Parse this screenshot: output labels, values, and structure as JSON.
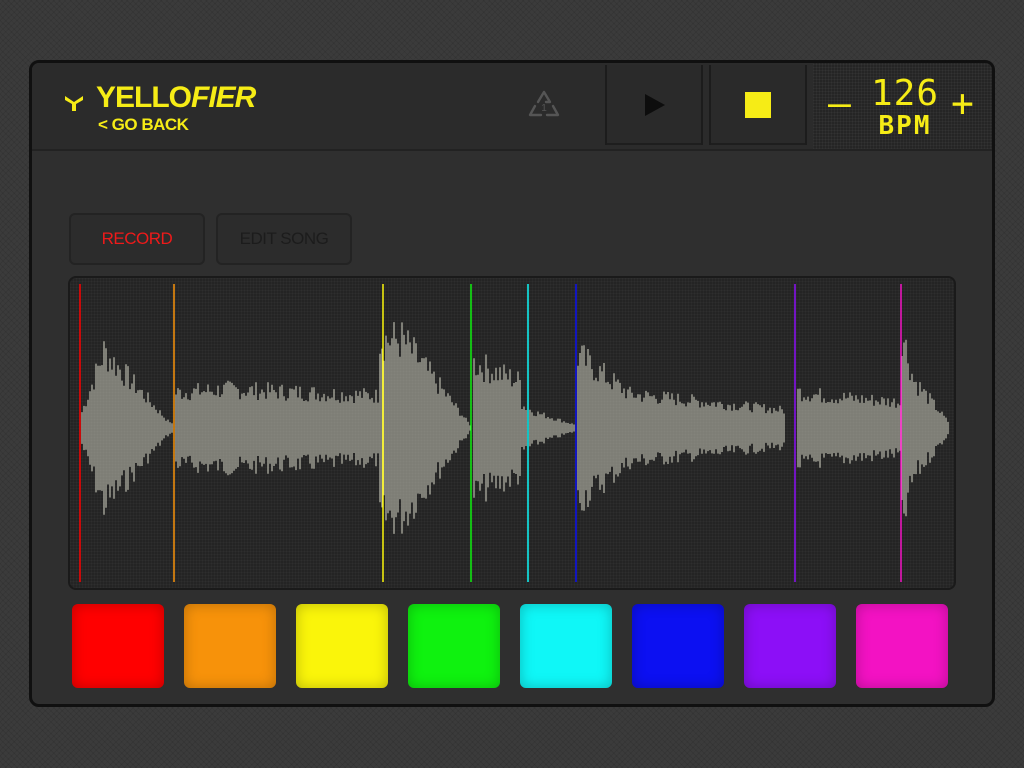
{
  "header": {
    "brand_part1": "YELLO",
    "brand_part2": "FIER",
    "go_back": "< GO BACK",
    "logo_icon": "yellofier-logo-icon",
    "recycle_icon": "recycle-icon",
    "recycle_badge": "1"
  },
  "transport": {
    "play_icon": "play-icon",
    "stop_icon": "stop-icon",
    "bpm_value": "126",
    "bpm_label": "BPM",
    "bpm_minus": "–",
    "bpm_plus": "+"
  },
  "tabs": [
    {
      "label": "RECORD",
      "active": true,
      "color": "#ee1a1a"
    },
    {
      "label": "EDIT SONG",
      "active": false
    }
  ],
  "pads": [
    {
      "name": "red",
      "color": "#ff0000"
    },
    {
      "name": "orange",
      "color": "#f7920a"
    },
    {
      "name": "yellow",
      "color": "#faf50a"
    },
    {
      "name": "green",
      "color": "#0ff20f"
    },
    {
      "name": "cyan",
      "color": "#0ff7f7"
    },
    {
      "name": "blue",
      "color": "#0c10f2"
    },
    {
      "name": "purple",
      "color": "#8c0ff7"
    },
    {
      "name": "magenta",
      "color": "#f312c3"
    }
  ],
  "accent_color": "#f6ec16"
}
